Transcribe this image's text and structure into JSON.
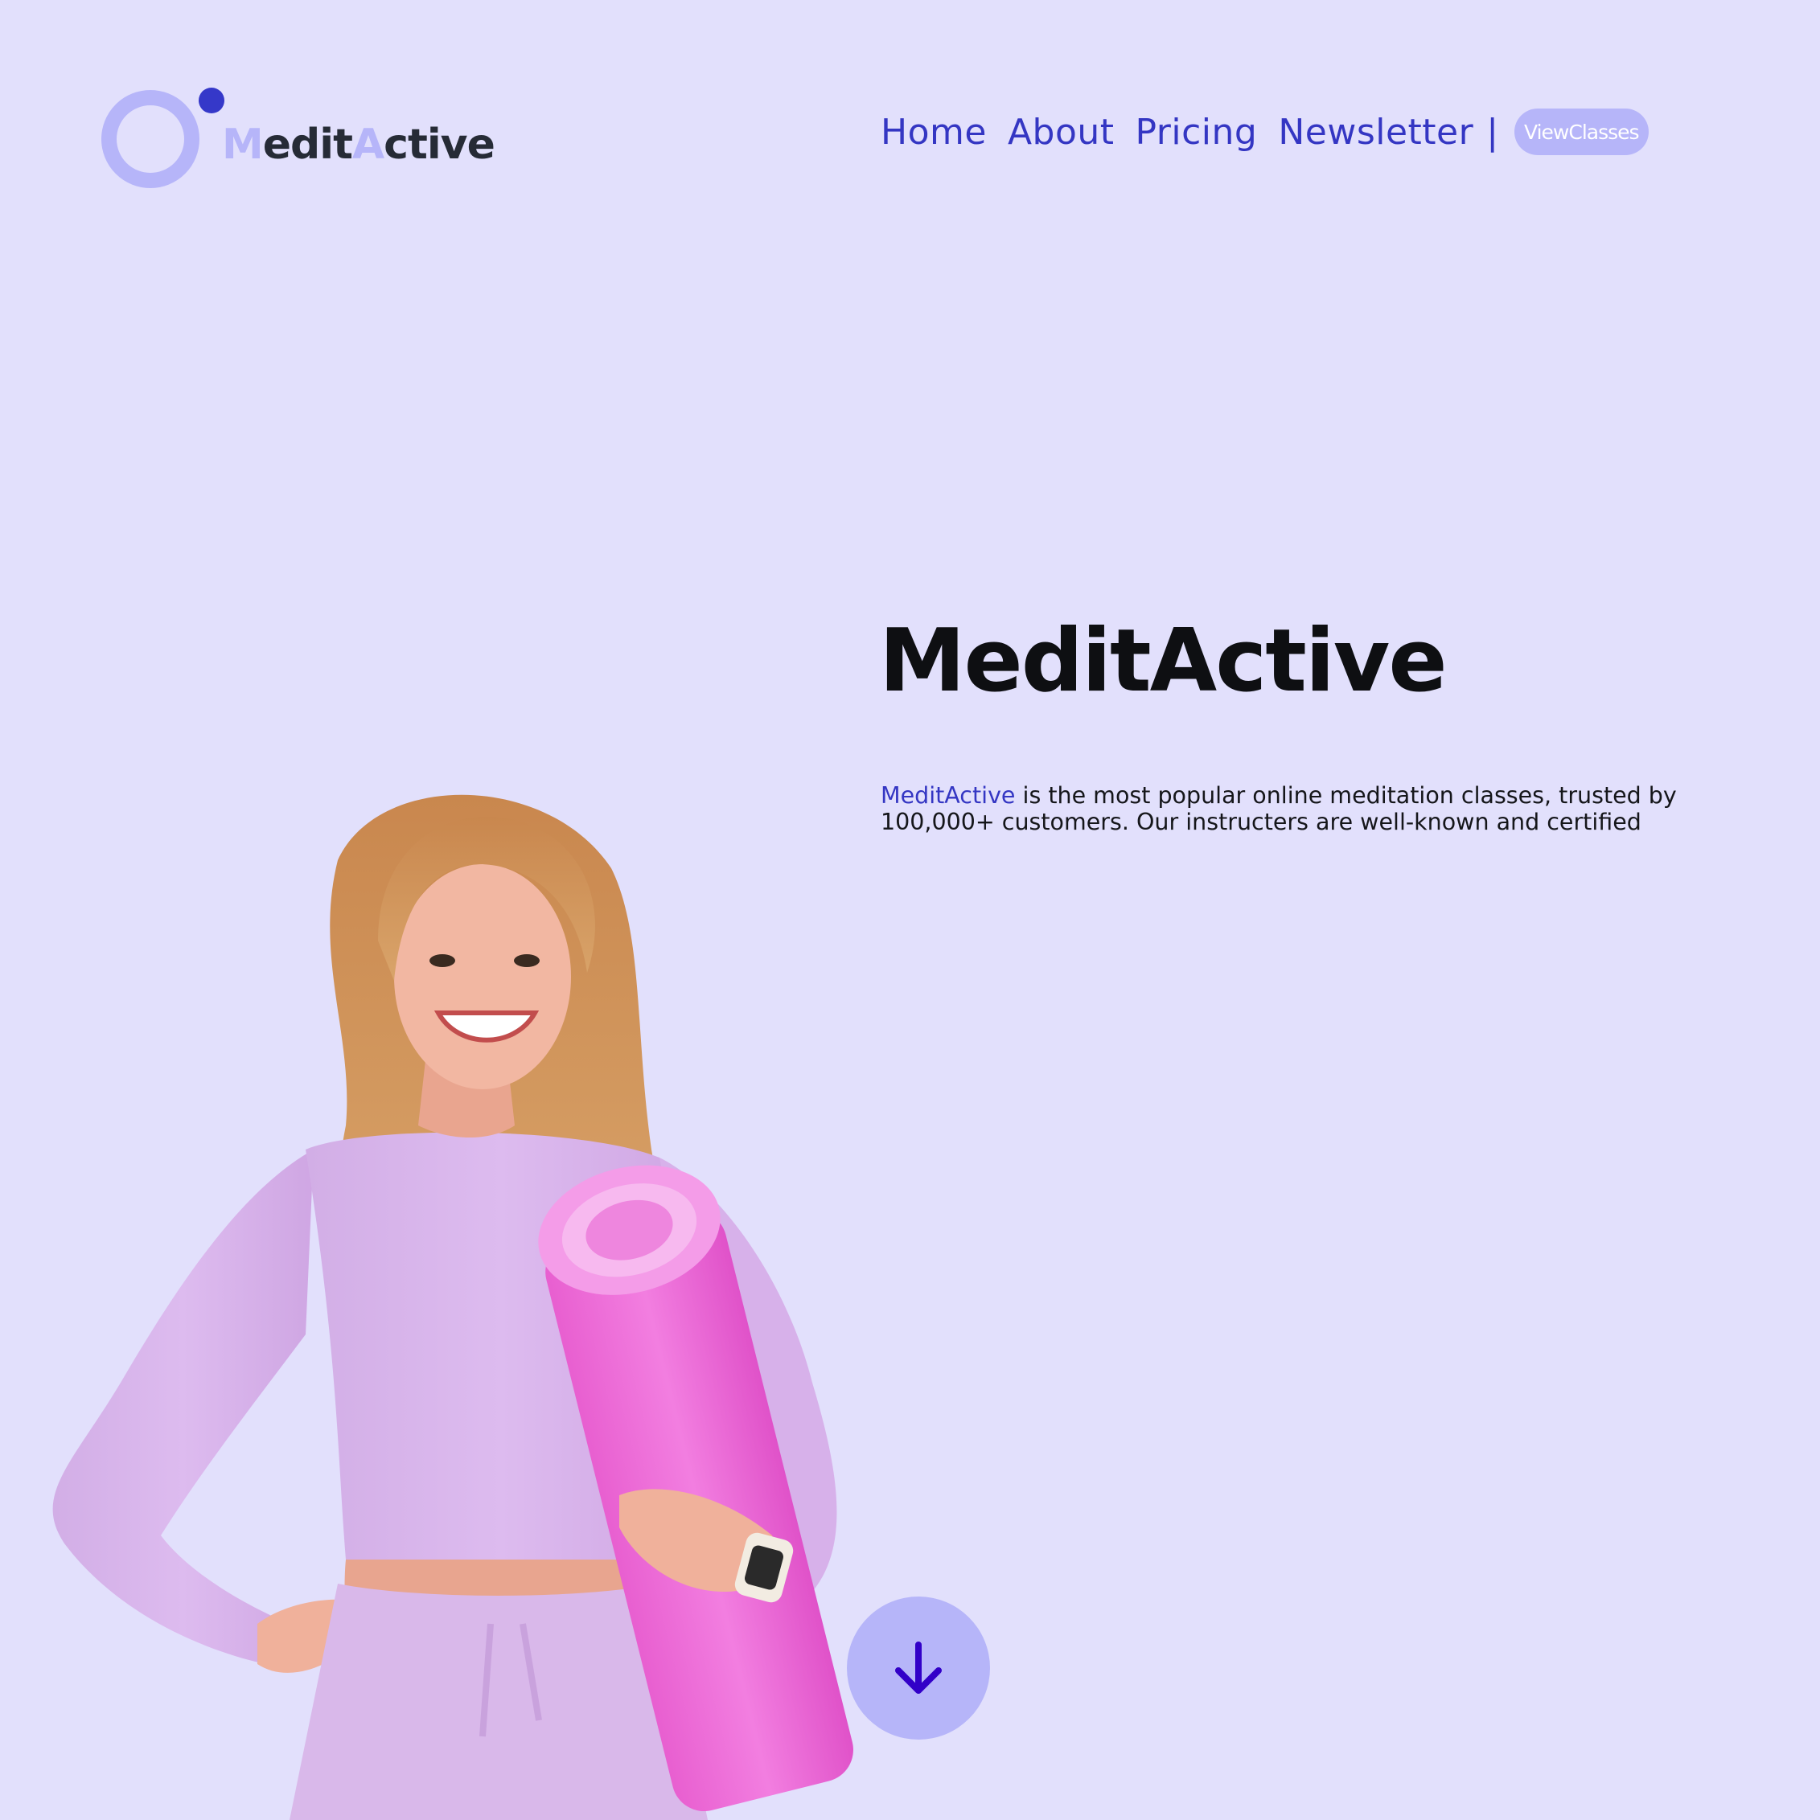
{
  "brand": {
    "logo_parts": [
      "M",
      "edit",
      "A",
      "ctive"
    ]
  },
  "nav": {
    "links": [
      "Home",
      "About",
      "Pricing",
      "Newsletter"
    ],
    "separator": "|",
    "cta_label": "ViewClasses"
  },
  "hero": {
    "title": "MeditActive",
    "desc_brand": "MeditActive",
    "desc_text": " is the most popular online meditation classes, trusted by 100,000+ customers. Our instructers are well-known and certified"
  },
  "icons": {
    "logo": "circle-logo-icon",
    "scroll": "arrow-down-icon"
  },
  "colors": {
    "background": "#e2e0fc",
    "accent_light": "#b6b5f9",
    "accent_dark": "#3436c3",
    "text": "#0e0f12"
  }
}
